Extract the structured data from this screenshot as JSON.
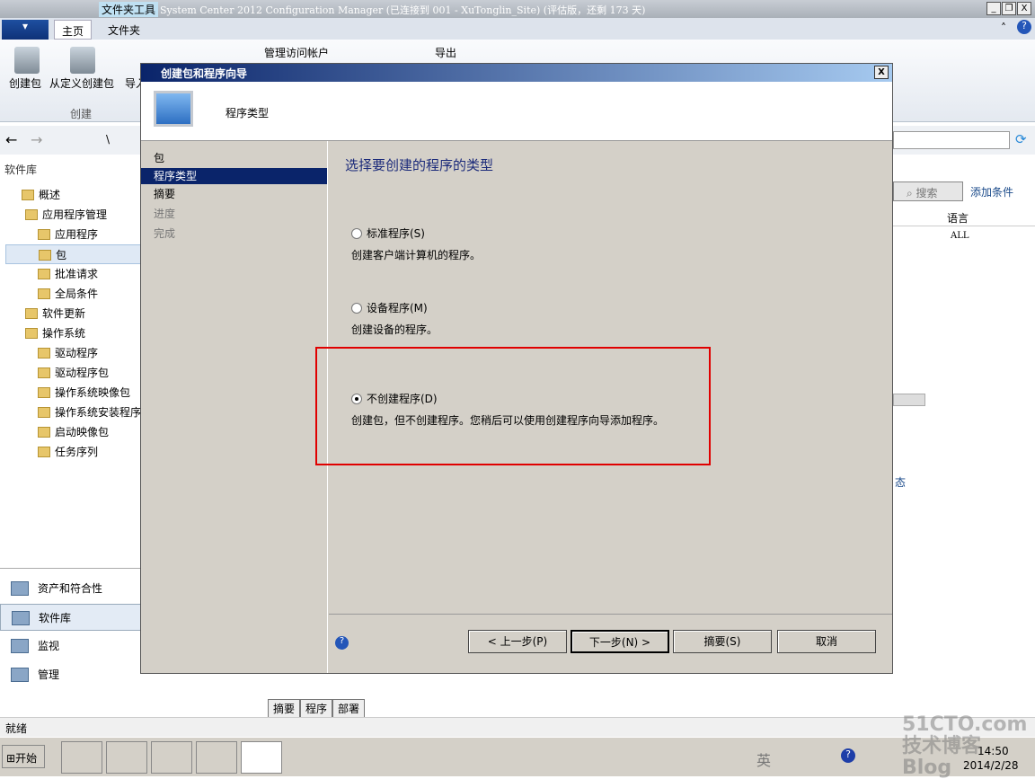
{
  "window": {
    "context_tab": "文件夹工具",
    "title": "System Center 2012 Configuration Manager (已连接到 001 - XuTonglin_Site) (评估版，还剩 173 天)"
  },
  "ribbon": {
    "tabs": [
      "主页",
      "文件夹"
    ],
    "buttons": [
      "创建包",
      "从定义创建包",
      "导入"
    ],
    "group": "创建",
    "manage_accounts": "管理访问帐户",
    "export": "导出"
  },
  "nav": {
    "path": "\\"
  },
  "left": {
    "title": "软件库",
    "tree": [
      "概述",
      "应用程序管理",
      "应用程序",
      "包",
      "批准请求",
      "全局条件",
      "软件更新",
      "操作系统",
      "驱动程序",
      "驱动程序包",
      "操作系统映像包",
      "操作系统安装程序",
      "启动映像包",
      "任务序列"
    ],
    "workspaces": [
      "资产和符合性",
      "软件库",
      "监视",
      "管理"
    ]
  },
  "right": {
    "search": "搜索",
    "add_criteria": "添加条件",
    "col_language": "语言",
    "cell_language": "ALL",
    "status_fragment": "态"
  },
  "bottom_tabs": [
    "摘要",
    "程序",
    "部署"
  ],
  "status": "就绪",
  "taskbar": {
    "start": "开始",
    "ime": "英",
    "time": "14:50",
    "date": "2014/2/28"
  },
  "dialog": {
    "title": "创建包和程序向导",
    "header": "程序类型",
    "steps": [
      "包",
      "程序类型",
      "摘要",
      "进度",
      "完成"
    ],
    "heading": "选择要创建的程序的类型",
    "options": [
      {
        "label": "标准程序(S)",
        "desc": "创建客户端计算机的程序。",
        "selected": false
      },
      {
        "label": "设备程序(M)",
        "desc": "创建设备的程序。",
        "selected": false
      },
      {
        "label": "不创建程序(D)",
        "desc": "创建包，但不创建程序。您稍后可以使用创建程序向导添加程序。",
        "selected": true
      }
    ],
    "buttons": {
      "back": "< 上一步(P)",
      "next": "下一步(N) >",
      "summary": "摘要(S)",
      "cancel": "取消"
    }
  },
  "watermark": "51CTO.com 技术博客 Blog"
}
